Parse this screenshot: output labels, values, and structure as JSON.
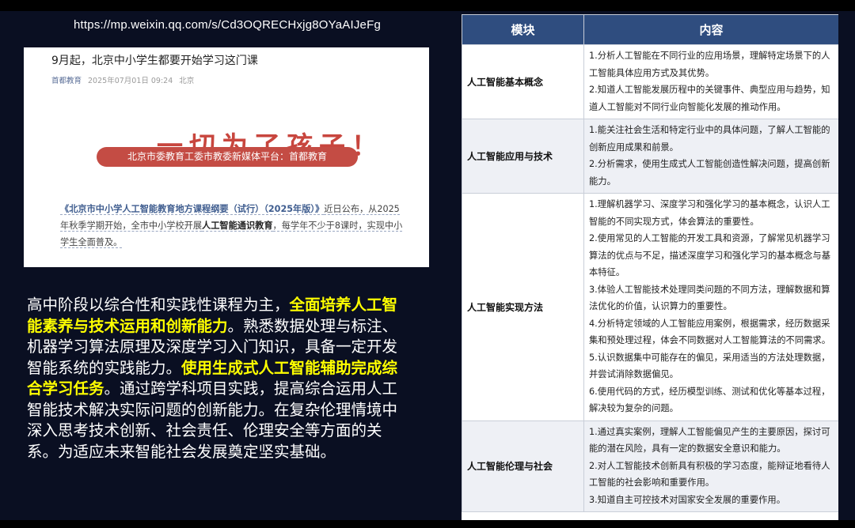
{
  "url": "https://mp.weixin.qq.com/s/Cd3OQRECHxjg8OYaAIJeFg",
  "article": {
    "title": "9月起，北京中小学生都要开始学习这门课",
    "source": "首都教育",
    "datetime": "2025年07月01日 09:24",
    "location": "北京",
    "slogan": "一切为了孩子！",
    "banner": "北京市委教育工委市教委新媒体平台：首都教育",
    "body_title": "《北京市中小学人工智能教育地方课程纲要（试行）（2025年版）》",
    "body_1": "近日公布，从2025年秋季学期开始，全市中小学校开展",
    "body_strong": "人工智能通识教育",
    "body_2": "，每学年不少于8课时，实现中小学生全面普及。"
  },
  "main_text": {
    "p1": "高中阶段以综合性和实践性课程为主，",
    "h1": "全面培养人工智能素养与技术运用和创新能力",
    "p2": "。熟悉数据处理与标注、机器学习算法原理及深度学习入门知识，具备一定开发智能系统的实践能力。",
    "h2": "使用生成式人工智能辅助完成综合学习任务",
    "p3": "。通过跨学科项目实践，提高综合运用人工智能技术解决实际问题的创新能力。在复杂伦理情境中深入思考技术创新、社会责任、伦理安全等方面的关系。为适应未来智能社会发展奠定坚实基础。"
  },
  "table": {
    "headers": [
      "模块",
      "内容"
    ],
    "rows": [
      {
        "module": "人工智能基本概念",
        "items": [
          "1.分析人工智能在不同行业的应用场景，理解特定场景下的人工智能具体应用方式及其优势。",
          "2.知道人工智能发展历程中的关键事件、典型应用与趋势，知道人工智能对不同行业向智能化发展的推动作用。"
        ]
      },
      {
        "module": "人工智能应用与技术",
        "items": [
          "1.能关注社会生活和特定行业中的具体问题，了解人工智能的创新应用成果和前景。",
          "2.分析需求，使用生成式人工智能创造性解决问题，提高创新能力。"
        ]
      },
      {
        "module": "人工智能实现方法",
        "items": [
          "1.理解机器学习、深度学习和强化学习的基本概念，认识人工智能的不同实现方式，体会算法的重要性。",
          "2.使用常见的人工智能的开发工具和资源，了解常见机器学习算法的优点与不足，描述深度学习和强化学习的基本概念与基本特征。",
          "3.体验人工智能技术处理同类问题的不同方法，理解数据和算法优化的价值，认识算力的重要性。",
          "4.分析特定领域的人工智能应用案例，根据需求，经历数据采集和预处理过程，体会不同数据对人工智能算法的不同需求。",
          "5.认识数据集中可能存在的偏见，采用适当的方法处理数据，并尝试消除数据偏见。",
          "6.使用代码的方式，经历模型训练、测试和优化等基本过程，解决较为复杂的问题。"
        ]
      },
      {
        "module": "人工智能伦理与社会",
        "items": [
          "1.通过真实案例，理解人工智能偏见产生的主要原因，探讨可能的潜在风险，具有一定的数据安全意识和能力。",
          "2.对人工智能技术创新具有积极的学习态度，能辩证地看待人工智能的社会影响和重要作用。",
          "3.知道自主可控技术对国家安全发展的重要作用。"
        ]
      }
    ]
  }
}
